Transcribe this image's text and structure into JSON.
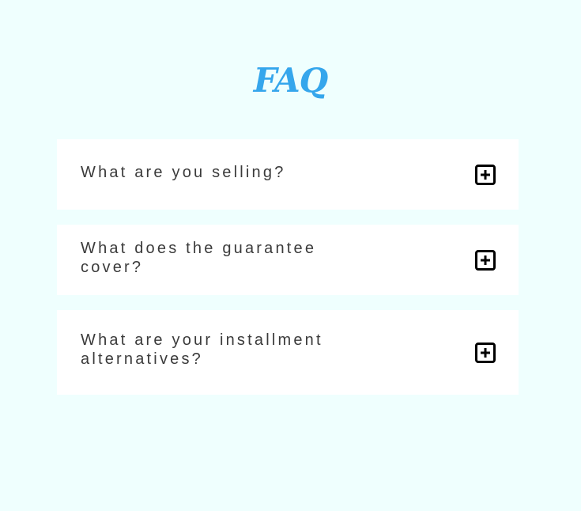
{
  "page": {
    "title": "FAQ"
  },
  "faq": {
    "items": [
      {
        "question": "What are you selling?",
        "icon": "plus-square-icon"
      },
      {
        "question": "What does the guarantee cover?",
        "icon": "plus-square-icon"
      },
      {
        "question": "What are your installment alternatives?",
        "icon": "plus-square-icon"
      }
    ]
  },
  "colors": {
    "background": "#effffe",
    "title": "#35a6ec",
    "card": "#ffffff",
    "text": "#3b3b3b",
    "icon": "#000000"
  }
}
